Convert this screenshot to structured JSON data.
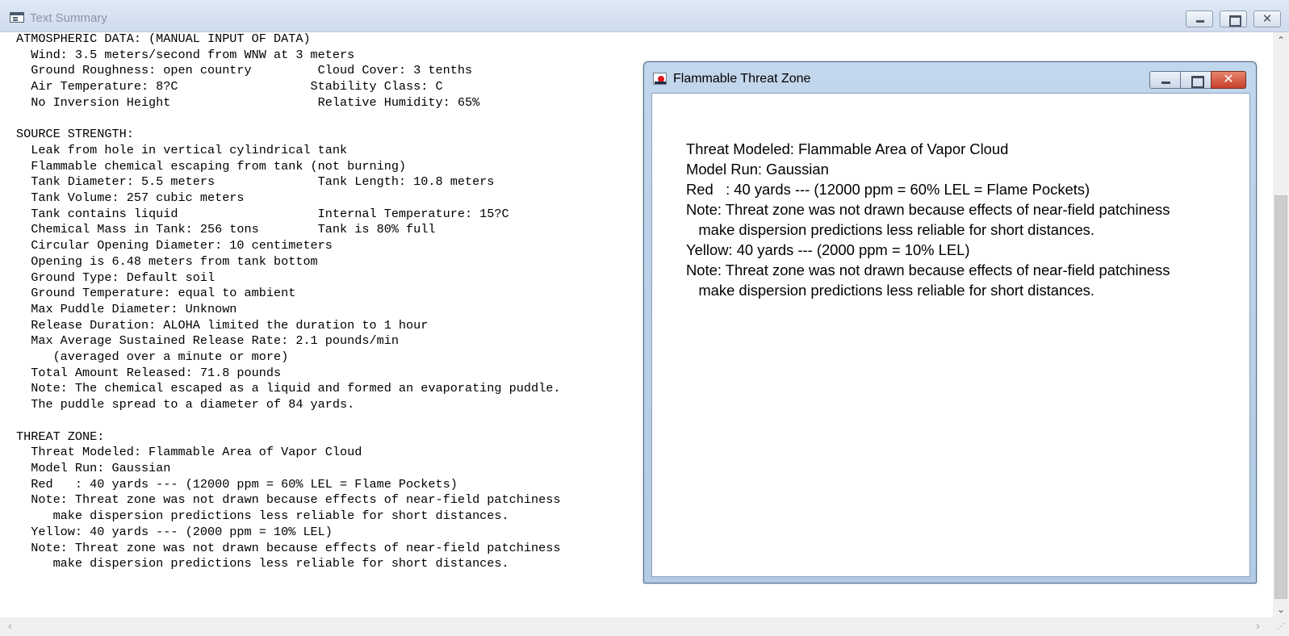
{
  "outer_window": {
    "title": "Text Summary",
    "controls": {
      "close_glyph": "✕"
    }
  },
  "summary_lines": [
    "ATMOSPHERIC DATA: (MANUAL INPUT OF DATA)",
    "  Wind: 3.5 meters/second from WNW at 3 meters",
    "  Ground Roughness: open country         Cloud Cover: 3 tenths",
    "  Air Temperature: 8?C                  Stability Class: C",
    "  No Inversion Height                    Relative Humidity: 65%",
    "",
    "SOURCE STRENGTH:",
    "  Leak from hole in vertical cylindrical tank",
    "  Flammable chemical escaping from tank (not burning)",
    "  Tank Diameter: 5.5 meters              Tank Length: 10.8 meters",
    "  Tank Volume: 257 cubic meters",
    "  Tank contains liquid                   Internal Temperature: 15?C",
    "  Chemical Mass in Tank: 256 tons        Tank is 80% full",
    "  Circular Opening Diameter: 10 centimeters",
    "  Opening is 6.48 meters from tank bottom",
    "  Ground Type: Default soil",
    "  Ground Temperature: equal to ambient",
    "  Max Puddle Diameter: Unknown",
    "  Release Duration: ALOHA limited the duration to 1 hour",
    "  Max Average Sustained Release Rate: 2.1 pounds/min",
    "     (averaged over a minute or more)",
    "  Total Amount Released: 71.8 pounds",
    "  Note: The chemical escaped as a liquid and formed an evaporating puddle.",
    "  The puddle spread to a diameter of 84 yards.",
    "",
    "THREAT ZONE:",
    "  Threat Modeled: Flammable Area of Vapor Cloud",
    "  Model Run: Gaussian",
    "  Red   : 40 yards --- (12000 ppm = 60% LEL = Flame Pockets)",
    "  Note: Threat zone was not drawn because effects of near-field patchiness",
    "     make dispersion predictions less reliable for short distances.",
    "  Yellow: 40 yards --- (2000 ppm = 10% LEL)",
    "  Note: Threat zone was not drawn because effects of near-field patchiness",
    "     make dispersion predictions less reliable for short distances."
  ],
  "inner_window": {
    "title": "Flammable Threat Zone",
    "controls": {
      "close_glyph": "✕"
    },
    "lines": [
      "Threat Modeled: Flammable Area of Vapor Cloud",
      "Model Run: Gaussian",
      "Red   : 40 yards --- (12000 ppm = 60% LEL = Flame Pockets)",
      "Note: Threat zone was not drawn because effects of near-field patchiness",
      "   make dispersion predictions less reliable for short distances.",
      "Yellow: 40 yards --- (2000 ppm = 10% LEL)",
      "Note: Threat zone was not drawn because effects of near-field patchiness",
      "   make dispersion predictions less reliable for short distances."
    ]
  },
  "scrollbars": {
    "up_arrow": "⌃",
    "down_arrow": "⌄",
    "left_arrow": "‹",
    "right_arrow": "›",
    "grip": "⋰"
  },
  "colors": {
    "titlebar_inactive": "#cfdced",
    "inner_frame": "#b3cbe5",
    "close_button": "#c7402a",
    "text": "#000000"
  },
  "icons": {
    "outer_app": "console-window-icon",
    "inner_app": "flammable-threat-icon"
  }
}
